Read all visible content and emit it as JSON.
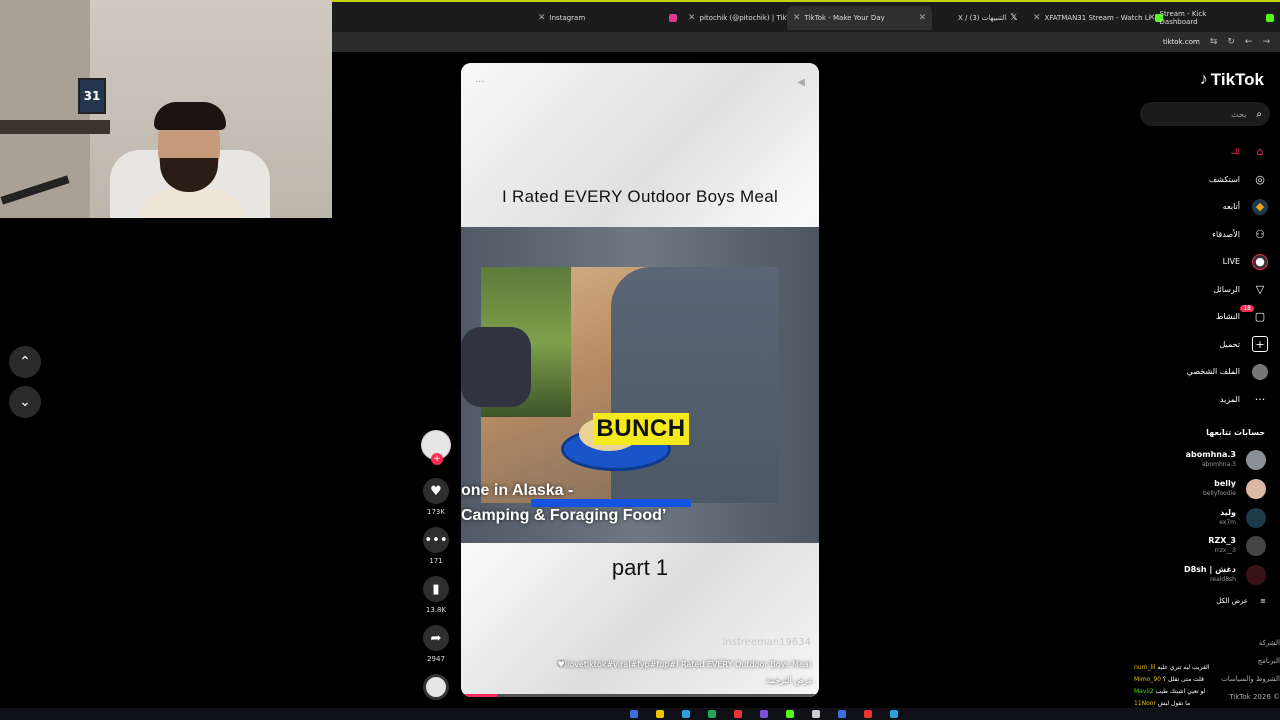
{
  "browser": {
    "tabs": [
      {
        "label": "Instagram",
        "color": "#d83c8b"
      },
      {
        "label": "pitochik (@pitochik) | TikTok",
        "color": "#ffffff"
      },
      {
        "label": "TikTok - Make Your Day",
        "color": "#ffffff"
      },
      {
        "label": "X / (3) التنبيهات",
        "color": "#ffffff"
      },
      {
        "label": "XFATMAN31 Stream - Watch Li",
        "color": "#53fc18"
      },
      {
        "label": "Stream - Kick Dashboard",
        "color": "#53fc18"
      }
    ],
    "url": "tiktok.com"
  },
  "webcam": {
    "jersey_number": "31"
  },
  "video": {
    "title": "I Rated EVERY Outdoor Boys Meal",
    "overlay_word": "BUNCH",
    "caption_line1": "one in Alaska -",
    "caption_line2": "Camping & Foraging Food’",
    "part_label": "part 1",
    "watermark": "instreeman19634",
    "hashtags": "♥ilovetiktok#viral#fyp#fup#I Rated EVERY Outdoor Boys Meal",
    "translate_label": "عرض الترجمة",
    "progress": 0.1
  },
  "actions": {
    "likes": "173K",
    "comments": "171",
    "saves": "13.8K",
    "shares": "2947"
  },
  "sidebar": {
    "logo": "TikTok",
    "search_placeholder": "بحث",
    "menu": [
      {
        "label": "لك",
        "icon": "home-icon",
        "active": true
      },
      {
        "label": "استكشف",
        "icon": "explore-icon"
      },
      {
        "label": "أتابعه",
        "icon": "following-icon"
      },
      {
        "label": "الأصدقاء",
        "icon": "friends-icon"
      },
      {
        "label": "LIVE",
        "icon": "live-icon"
      },
      {
        "label": "الرسائل",
        "icon": "messages-icon"
      },
      {
        "label": "النشاط",
        "icon": "activity-icon",
        "badge": "18"
      },
      {
        "label": "تحميل",
        "icon": "upload-icon"
      },
      {
        "label": "الملف الشخصي",
        "icon": "profile-icon"
      },
      {
        "label": "المزيد",
        "icon": "more-icon"
      }
    ],
    "following_title": "حسابات تتابعها",
    "accounts": [
      {
        "name": "abomhna.3",
        "handle": "abomhna.3"
      },
      {
        "name": "belly",
        "handle": "bellyfoodie"
      },
      {
        "name": "وليد",
        "handle": "ex7m"
      },
      {
        "name": "RZX_3",
        "handle": "rrzx__3"
      },
      {
        "name": "D8sh | دغش",
        "handle": "reald8sh"
      }
    ],
    "see_all": "عرض الكل",
    "footer": [
      "الشركة",
      "البرنامج",
      "الشروط والسياسات",
      "TikTok 2026 ©"
    ]
  },
  "chat": [
    {
      "user": "num_lil",
      "text": "القريب ليه تتري عليه"
    },
    {
      "user": "Mimo_90",
      "text": "قلت متى تقلل ؟"
    },
    {
      "user": "Mavii2",
      "text": "لو تعيي اشيتك طيب"
    },
    {
      "user": "11Noor",
      "text": "ما تقول ليش"
    }
  ]
}
